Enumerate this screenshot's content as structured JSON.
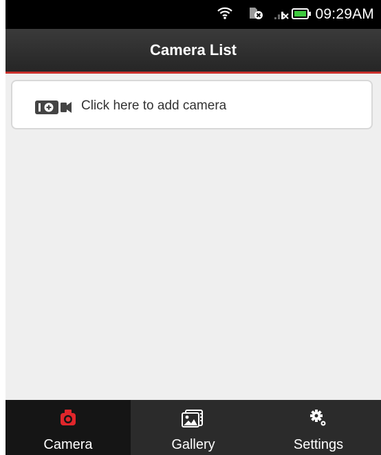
{
  "status_bar": {
    "time": "09:29AM"
  },
  "header": {
    "title": "Camera List"
  },
  "main": {
    "add_camera_label": "Click here to add camera"
  },
  "bottom_nav": {
    "tabs": [
      {
        "label": "Camera",
        "icon": "camera-icon",
        "active": true
      },
      {
        "label": "Gallery",
        "icon": "gallery-icon",
        "active": false
      },
      {
        "label": "Settings",
        "icon": "gear-icon",
        "active": false
      }
    ]
  },
  "colors": {
    "accent": "#c9302c",
    "status_bar_bg": "#000000",
    "header_bg": "#2e2e2e",
    "content_bg": "#efefef",
    "nav_bg": "#2b2b2b",
    "battery": "#3fc93f"
  }
}
